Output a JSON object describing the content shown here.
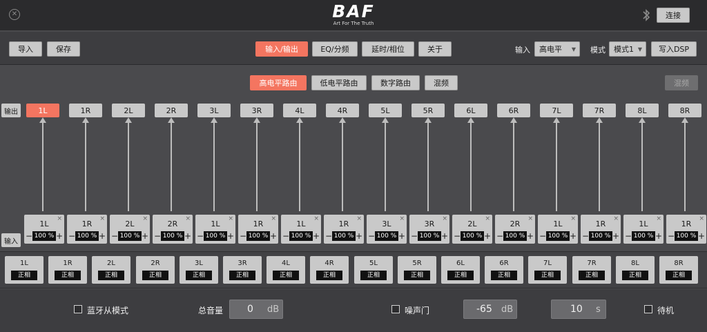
{
  "titlebar": {
    "logo_main": "BAF",
    "logo_sub": "Art For The Truth",
    "connect_label": "连接",
    "close_glyph": "✕",
    "bt_icon": "bluetooth-icon"
  },
  "toolbar": {
    "import_label": "导入",
    "save_label": "保存",
    "tabs": [
      {
        "label": "输入/输出",
        "active": true
      },
      {
        "label": "EQ/分频",
        "active": false
      },
      {
        "label": "延时/相位",
        "active": false
      },
      {
        "label": "关于",
        "active": false
      }
    ],
    "input_label": "输入",
    "input_value": "高电平",
    "mode_label": "模式",
    "mode_value": "模式1",
    "write_dsp_label": "写入DSP"
  },
  "routing": {
    "tabs": [
      {
        "label": "高电平路由",
        "active": true
      },
      {
        "label": "低电平路由",
        "active": false
      },
      {
        "label": "数字路由",
        "active": false
      },
      {
        "label": "混频",
        "active": false
      }
    ],
    "mix_label": "混频"
  },
  "outputs": {
    "row_label": "输出",
    "channels": [
      {
        "label": "1L",
        "active": true
      },
      {
        "label": "1R",
        "active": false
      },
      {
        "label": "2L",
        "active": false
      },
      {
        "label": "2R",
        "active": false
      },
      {
        "label": "3L",
        "active": false
      },
      {
        "label": "3R",
        "active": false
      },
      {
        "label": "4L",
        "active": false
      },
      {
        "label": "4R",
        "active": false
      },
      {
        "label": "5L",
        "active": false
      },
      {
        "label": "5R",
        "active": false
      },
      {
        "label": "6L",
        "active": false
      },
      {
        "label": "6R",
        "active": false
      },
      {
        "label": "7L",
        "active": false
      },
      {
        "label": "7R",
        "active": false
      },
      {
        "label": "8L",
        "active": false
      },
      {
        "label": "8R",
        "active": false
      }
    ]
  },
  "inputs": {
    "row_label": "输入",
    "remove_glyph": "×",
    "minus_glyph": "−",
    "plus_glyph": "+",
    "mixers": [
      {
        "source": "1L",
        "level": "100 %"
      },
      {
        "source": "1R",
        "level": "100 %"
      },
      {
        "source": "2L",
        "level": "100 %"
      },
      {
        "source": "2R",
        "level": "100 %"
      },
      {
        "source": "1L",
        "level": "100 %"
      },
      {
        "source": "1R",
        "level": "100 %"
      },
      {
        "source": "1L",
        "level": "100 %"
      },
      {
        "source": "1R",
        "level": "100 %"
      },
      {
        "source": "3L",
        "level": "100 %"
      },
      {
        "source": "3R",
        "level": "100 %"
      },
      {
        "source": "2L",
        "level": "100 %"
      },
      {
        "source": "2R",
        "level": "100 %"
      },
      {
        "source": "1L",
        "level": "100 %"
      },
      {
        "source": "1R",
        "level": "100 %"
      },
      {
        "source": "1L",
        "level": "100 %"
      },
      {
        "source": "1R",
        "level": "100 %"
      }
    ]
  },
  "phase": {
    "channels": [
      {
        "label": "1L",
        "value": "正相"
      },
      {
        "label": "1R",
        "value": "正相"
      },
      {
        "label": "2L",
        "value": "正相"
      },
      {
        "label": "2R",
        "value": "正相"
      },
      {
        "label": "3L",
        "value": "正相"
      },
      {
        "label": "3R",
        "value": "正相"
      },
      {
        "label": "4L",
        "value": "正相"
      },
      {
        "label": "4R",
        "value": "正相"
      },
      {
        "label": "5L",
        "value": "正相"
      },
      {
        "label": "5R",
        "value": "正相"
      },
      {
        "label": "6L",
        "value": "正相"
      },
      {
        "label": "6R",
        "value": "正相"
      },
      {
        "label": "7L",
        "value": "正相"
      },
      {
        "label": "7R",
        "value": "正相"
      },
      {
        "label": "8L",
        "value": "正相"
      },
      {
        "label": "8R",
        "value": "正相"
      }
    ]
  },
  "bottom": {
    "bt_slave_label": "蓝牙从模式",
    "master_volume_label": "总音量",
    "master_volume_value": "0",
    "master_volume_unit": "dB",
    "noise_gate_label": "噪声门",
    "noise_gate_value": "-65",
    "noise_gate_unit": "dB",
    "time_value": "10",
    "time_unit": "s",
    "standby_label": "待机"
  },
  "colors": {
    "accent": "#f47560",
    "background": "#4a4a4d",
    "button": "#c9c9c9"
  }
}
